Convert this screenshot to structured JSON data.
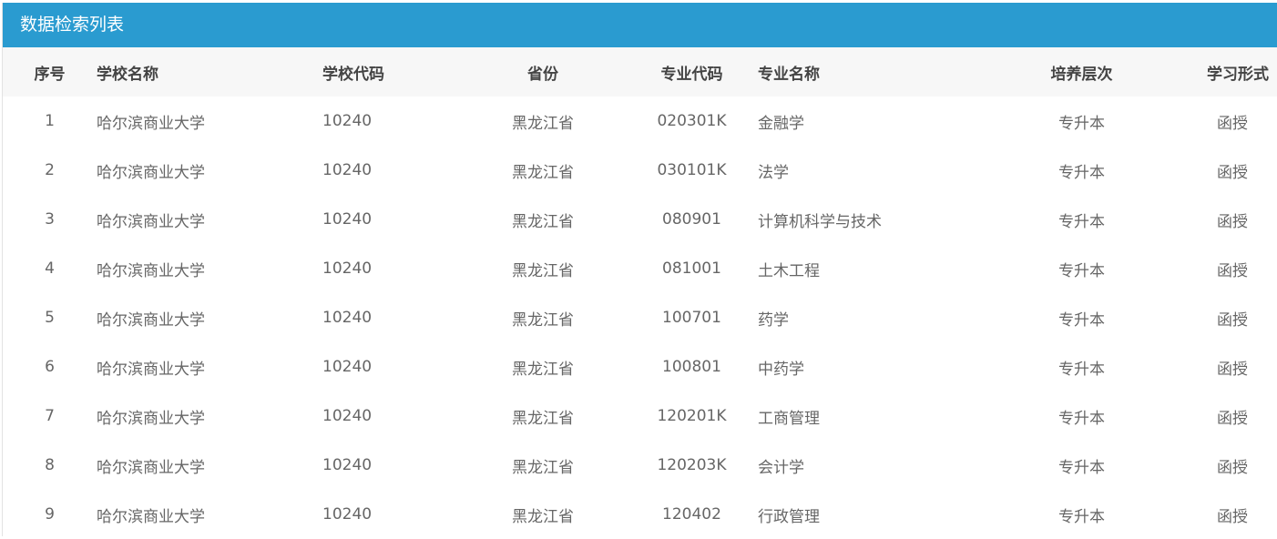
{
  "panel": {
    "title": "数据检索列表"
  },
  "columns": {
    "index": "序号",
    "school_name": "学校名称",
    "school_code": "学校代码",
    "province": "省份",
    "major_code": "专业代码",
    "major_name": "专业名称",
    "level": "培养层次",
    "study_form": "学习形式"
  },
  "rows": [
    {
      "index": "1",
      "school_name": "哈尔滨商业大学",
      "school_code": "10240",
      "province": "黑龙江省",
      "major_code": "020301K",
      "major_name": "金融学",
      "level": "专升本",
      "study_form": "函授"
    },
    {
      "index": "2",
      "school_name": "哈尔滨商业大学",
      "school_code": "10240",
      "province": "黑龙江省",
      "major_code": "030101K",
      "major_name": "法学",
      "level": "专升本",
      "study_form": "函授"
    },
    {
      "index": "3",
      "school_name": "哈尔滨商业大学",
      "school_code": "10240",
      "province": "黑龙江省",
      "major_code": "080901",
      "major_name": "计算机科学与技术",
      "level": "专升本",
      "study_form": "函授"
    },
    {
      "index": "4",
      "school_name": "哈尔滨商业大学",
      "school_code": "10240",
      "province": "黑龙江省",
      "major_code": "081001",
      "major_name": "土木工程",
      "level": "专升本",
      "study_form": "函授"
    },
    {
      "index": "5",
      "school_name": "哈尔滨商业大学",
      "school_code": "10240",
      "province": "黑龙江省",
      "major_code": "100701",
      "major_name": "药学",
      "level": "专升本",
      "study_form": "函授"
    },
    {
      "index": "6",
      "school_name": "哈尔滨商业大学",
      "school_code": "10240",
      "province": "黑龙江省",
      "major_code": "100801",
      "major_name": "中药学",
      "level": "专升本",
      "study_form": "函授"
    },
    {
      "index": "7",
      "school_name": "哈尔滨商业大学",
      "school_code": "10240",
      "province": "黑龙江省",
      "major_code": "120201K",
      "major_name": "工商管理",
      "level": "专升本",
      "study_form": "函授"
    },
    {
      "index": "8",
      "school_name": "哈尔滨商业大学",
      "school_code": "10240",
      "province": "黑龙江省",
      "major_code": "120203K",
      "major_name": "会计学",
      "level": "专升本",
      "study_form": "函授"
    },
    {
      "index": "9",
      "school_name": "哈尔滨商业大学",
      "school_code": "10240",
      "province": "黑龙江省",
      "major_code": "120402",
      "major_name": "行政管理",
      "level": "专升本",
      "study_form": "函授"
    }
  ],
  "colors": {
    "header_bg": "#2a9bd0",
    "table_head_bg": "#f7f7f7",
    "text": "#666666"
  }
}
